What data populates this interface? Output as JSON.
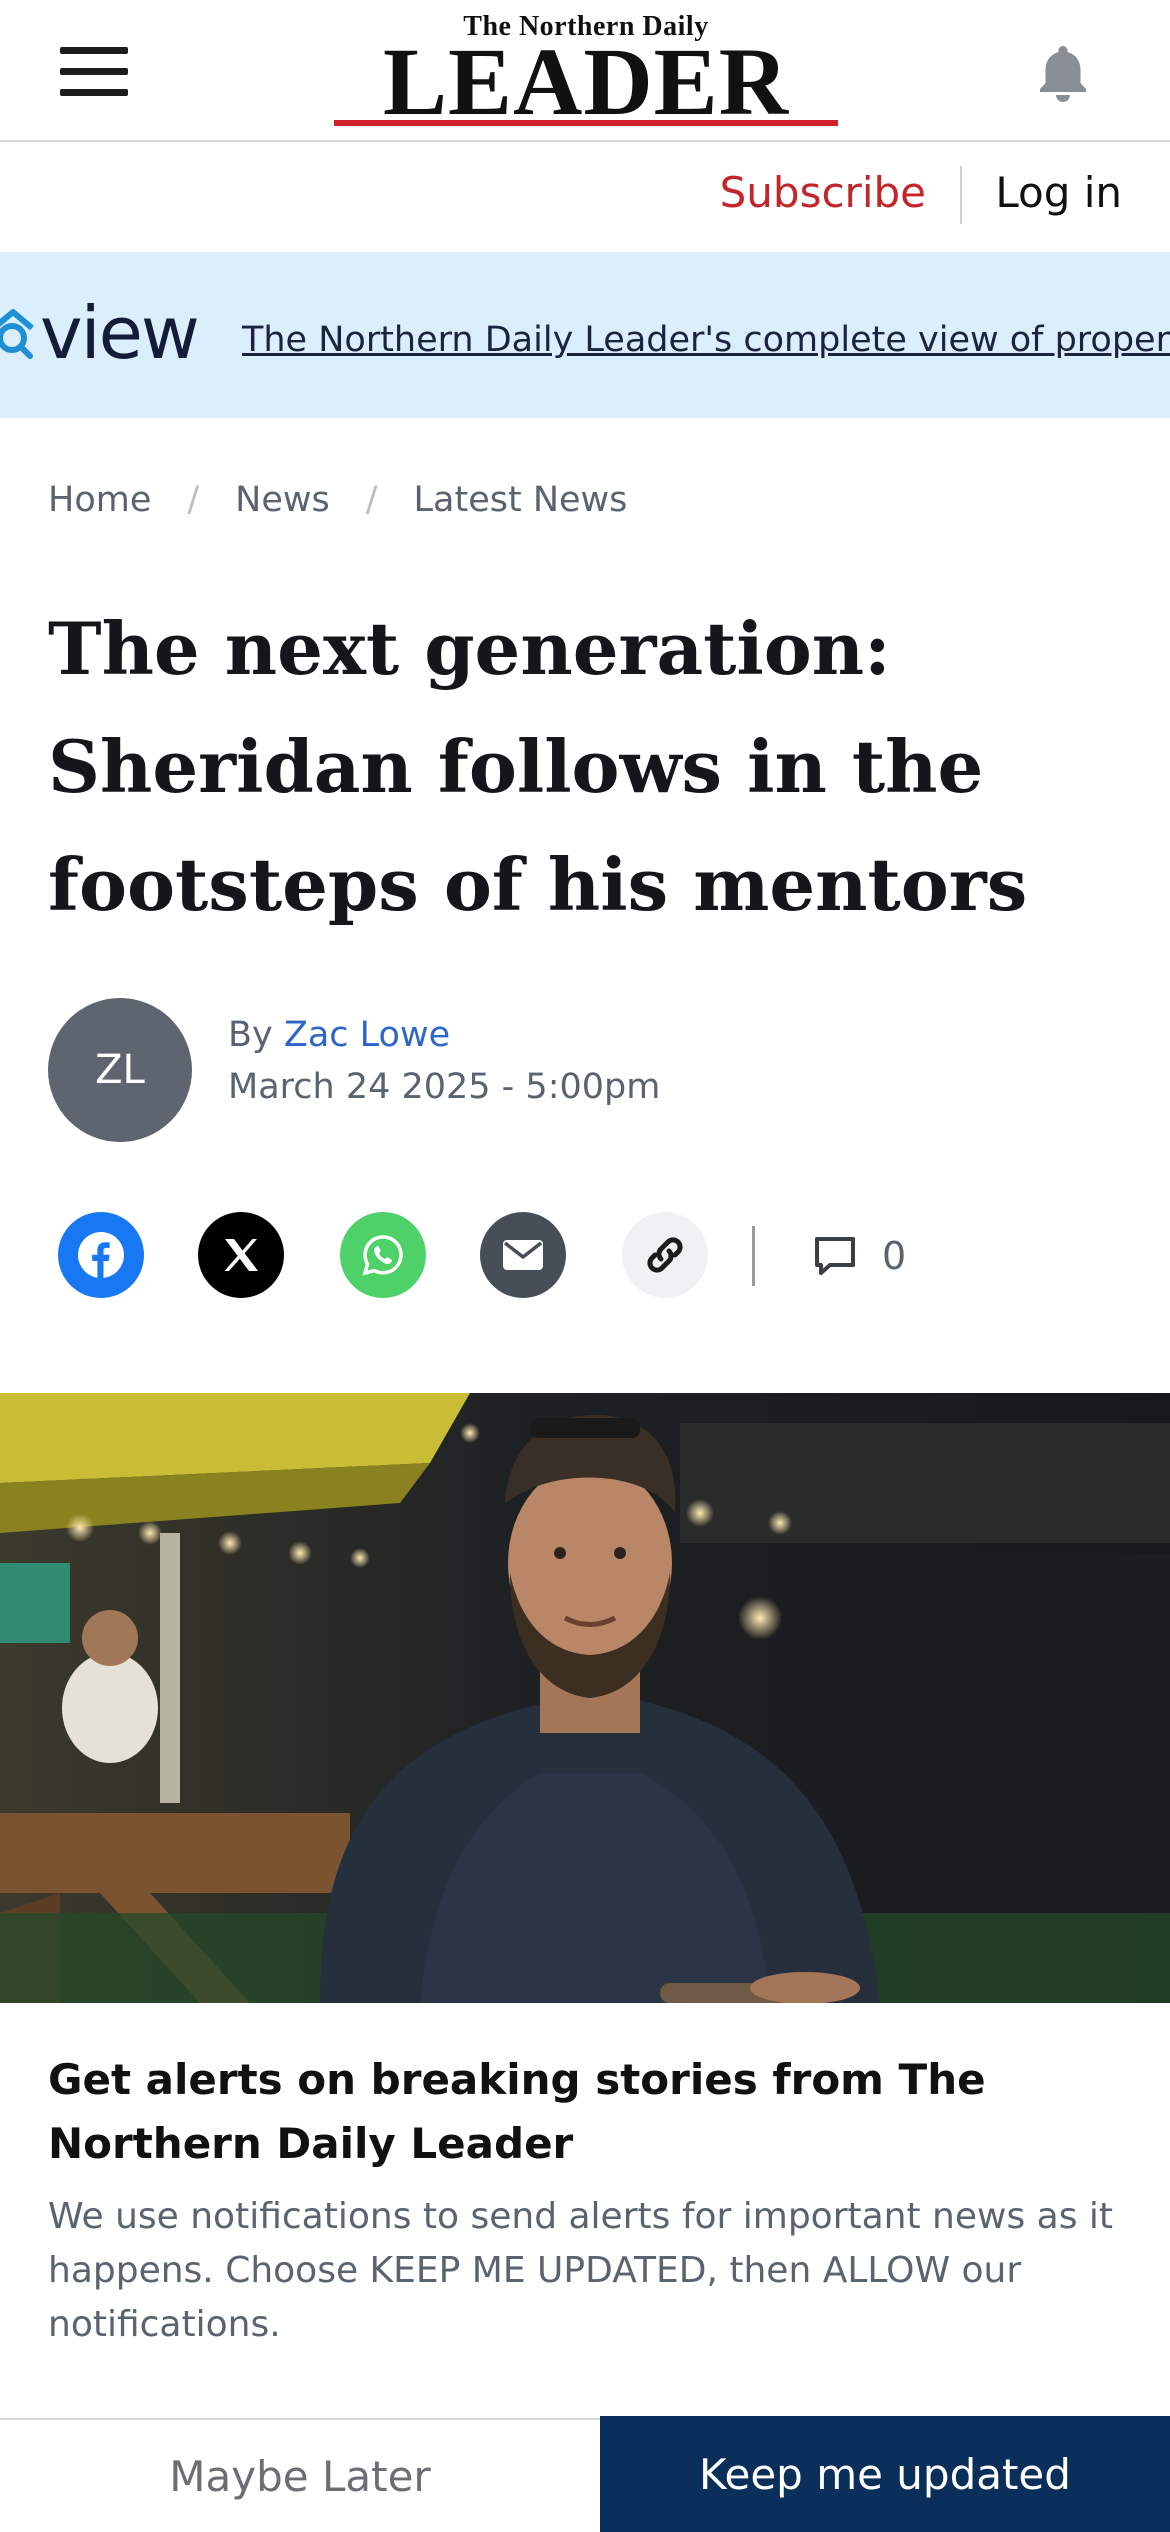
{
  "header": {
    "logo_top": "The Northern Daily",
    "logo_main": "LEADER",
    "menu_icon": "hamburger-menu-icon",
    "notification_icon": "bell-icon"
  },
  "account": {
    "subscribe_label": "Subscribe",
    "login_label": "Log in"
  },
  "banner": {
    "logo_text": "view",
    "link_text": "The Northern Daily Leader's complete view of property"
  },
  "breadcrumb": {
    "items": [
      "Home",
      "News",
      "Latest News"
    ],
    "separator": "/"
  },
  "article": {
    "headline": "The next generation: Sheridan follows in the footsteps of his mentors",
    "byline_prefix": "By",
    "author": "Zac Lowe",
    "author_initials": "ZL",
    "date": "March 24 2025 - 5:00pm"
  },
  "share": {
    "icons": [
      "facebook-icon",
      "x-icon",
      "whatsapp-icon",
      "email-icon",
      "link-icon",
      "comment-icon"
    ],
    "comment_count": "0"
  },
  "alert_prompt": {
    "title": "Get alerts on breaking stories from The Northern Daily Leader",
    "body": "We use notifications to send alerts for important news as it happens. Choose KEEP ME UPDATED, then ALLOW our notifications.",
    "secondary_button": "Maybe Later",
    "primary_button": "Keep me updated"
  },
  "colors": {
    "brand_red": "#c2262b",
    "banner_bg": "#dbeefb",
    "primary_button_bg": "#0b2f5b",
    "author_link": "#2e66c8"
  }
}
